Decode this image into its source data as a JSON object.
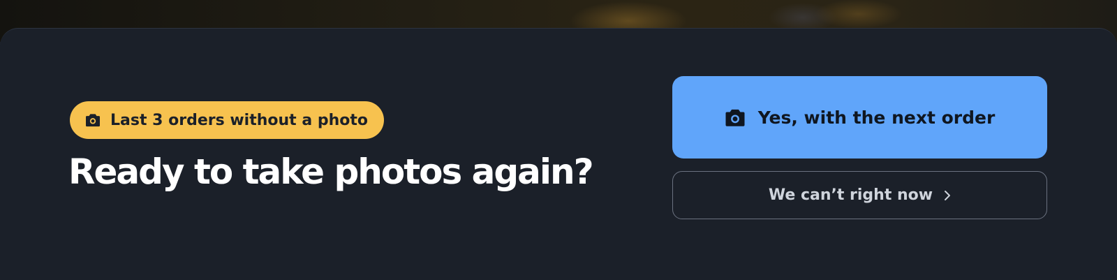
{
  "banner": {
    "badge_icon": "camera-icon",
    "badge_text": "Last 3 orders without a photo",
    "title": "Ready to take photos again?",
    "primary_button": {
      "icon": "camera-icon",
      "label": "Yes, with the next order"
    },
    "secondary_button": {
      "label": "We can’t right now",
      "icon": "chevron-right-icon"
    }
  },
  "colors": {
    "background": "#1b2029",
    "badge": "#f7c24f",
    "primary_button": "#60a5fa",
    "title_text": "#ffffff",
    "secondary_text": "#cfd4dc"
  }
}
